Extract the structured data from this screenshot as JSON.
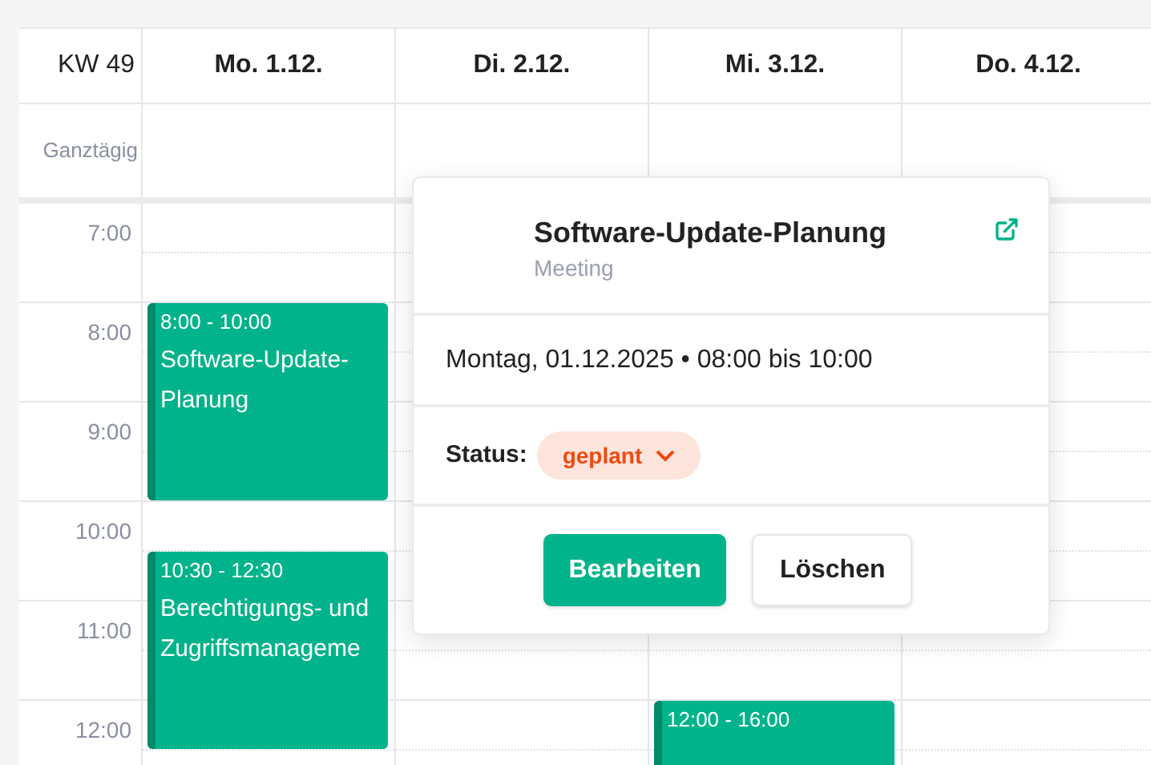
{
  "week": "KW 49",
  "days": [
    {
      "label": "Mo. 1.12.",
      "events": [
        {
          "time": "8:00 - 10:00",
          "title": "Software-Update-Planung"
        },
        {
          "time": "10:30 - 12:30",
          "title": "Berechtigungs- und Zugriffsmanageme"
        }
      ]
    },
    {
      "label": "Di. 2.12."
    },
    {
      "label": "Mi. 3.12.",
      "events": [
        {
          "time": "12:00 - 16:00"
        }
      ]
    },
    {
      "label": "Do. 4.12."
    }
  ],
  "all_day_label": "Ganztägig",
  "hours": [
    "7:00",
    "8:00",
    "9:00",
    "10:00",
    "11:00",
    "12:00"
  ],
  "popover": {
    "title": "Software-Update-Planung",
    "subtitle": "Meeting",
    "datetime": "Montag, 01.12.2025 • 08:00 bis 10:00",
    "status_label": "Status:",
    "status": "geplant",
    "buttons": [
      {
        "kind": "primary",
        "label": "Bearbeiten"
      },
      {
        "kind": "secondary",
        "label": "Löschen"
      }
    ]
  }
}
